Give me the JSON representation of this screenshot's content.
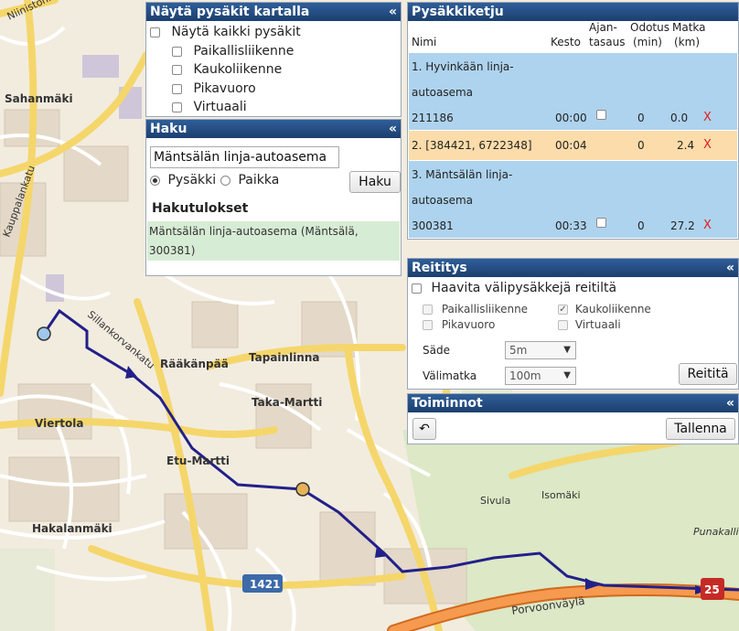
{
  "map": {
    "labels": {
      "ninisto": "Niinistönkatu",
      "sahanmaki": "Sahanmäki",
      "viertola": "Viertola",
      "hakalanmaki": "Hakalanmäki",
      "etu_martti": "Etu-Martti",
      "taka_martti": "Taka-Martti",
      "raakanpaa": "Rääkänpää",
      "tapainlinna": "Tapainlinna",
      "sivula": "Sivula",
      "isomaki": "Isomäki",
      "porvoonvayla": "Porvoonväylä",
      "sillankorvankatu": "Sillankorvankatu",
      "kauppalankatu": "Kauppalankatu",
      "road_1421": "1421",
      "road_25": "25",
      "punakallio": "Punakallio"
    },
    "colors": {
      "route": "#22208a",
      "highway": "#f08a3a",
      "road": "#f5d66b"
    }
  },
  "stops_panel": {
    "title": "Näytä pysäkit kartalla",
    "show_all": "Näytä kaikki pysäkit",
    "options": [
      "Paikallisliikenne",
      "Kaukoliikenne",
      "Pikavuoro",
      "Virtuaali"
    ]
  },
  "search_panel": {
    "title": "Haku",
    "input_value": "Mäntsälän linja-autoasema",
    "radio_stop": "Pysäkki",
    "radio_place": "Paikka",
    "button": "Haku",
    "results_title": "Hakutulokset",
    "result": "Mäntsälän linja-autoasema (Mäntsälä, 300381)"
  },
  "chain_panel": {
    "title": "Pysäkkiketju",
    "headers": {
      "name": "Nimi",
      "duration": "Kesto",
      "timing_1": "Ajan-",
      "timing_2": "tasaus",
      "wait_1": "Odotus",
      "wait_2": "(min)",
      "dist_1": "Matka",
      "dist_2": "(km)"
    },
    "stops": [
      {
        "name_1": "1. Hyvinkään linja-",
        "name_2": "autoasema",
        "code": "211186",
        "duration": "00:00",
        "wait": "0",
        "distance": "0.0"
      },
      {
        "name_1": "2. [384421, 6722348]",
        "duration": "00:04",
        "wait": "0",
        "distance": "2.4"
      },
      {
        "name_1": "3. Mäntsälän linja-",
        "name_2": "autoasema",
        "code": "300381",
        "duration": "00:33",
        "wait": "0",
        "distance": "27.2"
      }
    ],
    "delete_label": "X"
  },
  "routing_panel": {
    "title": "Reititys",
    "hide_label": "Haavita välipysäkkejä reitiltä",
    "options": {
      "local": "Paikallisliikenne",
      "long": "Kaukoliikenne",
      "express": "Pikavuoro",
      "virtual": "Virtuaali"
    },
    "radius_label": "Säde",
    "radius_value": "5m",
    "interval_label": "Välimatka",
    "interval_value": "100m",
    "button": "Reititä"
  },
  "actions_panel": {
    "title": "Toiminnot",
    "undo_icon": "undo-icon",
    "save_button": "Tallenna"
  },
  "collapse_glyph": "«"
}
